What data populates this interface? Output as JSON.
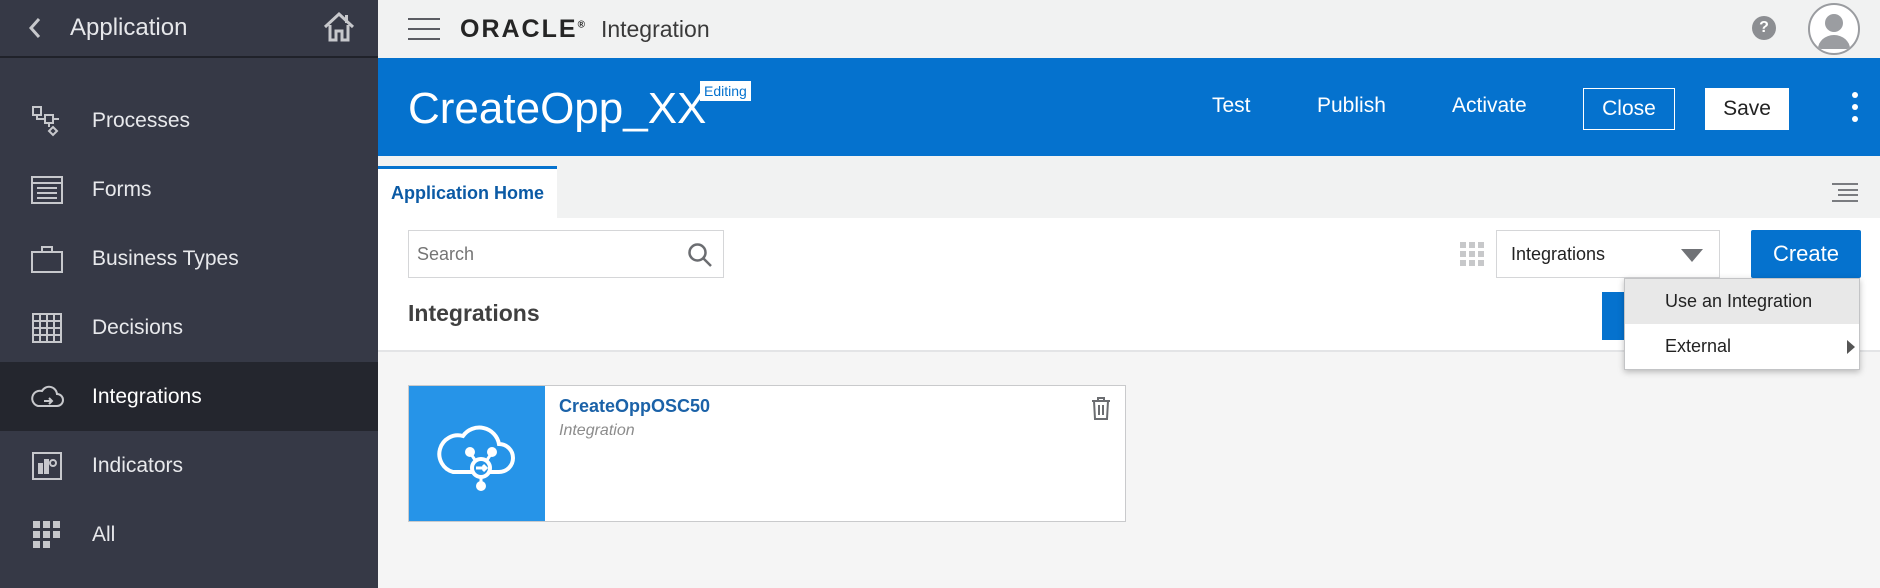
{
  "sidebar": {
    "title": "Application",
    "items": [
      {
        "label": "Processes",
        "icon": "process-icon"
      },
      {
        "label": "Forms",
        "icon": "form-icon"
      },
      {
        "label": "Business Types",
        "icon": "briefcase-icon"
      },
      {
        "label": "Decisions",
        "icon": "table-icon"
      },
      {
        "label": "Integrations",
        "icon": "cloud-icon",
        "active": true
      },
      {
        "label": "Indicators",
        "icon": "chart-icon"
      },
      {
        "label": "All",
        "icon": "grid-icon"
      }
    ]
  },
  "topbar": {
    "brand": "ORACLE",
    "product": "Integration",
    "help": "?"
  },
  "header": {
    "app_name": "CreateOpp_XX",
    "badge": "Editing",
    "test": "Test",
    "publish": "Publish",
    "activate": "Activate",
    "close": "Close",
    "save": "Save"
  },
  "tabs": {
    "active": "Application Home"
  },
  "toolbar": {
    "search_placeholder": "Search",
    "filter_value": "Integrations",
    "create": "Create"
  },
  "section": {
    "title": "Integrations"
  },
  "cards": [
    {
      "title": "CreateOppOSC50",
      "subtitle": "Integration"
    }
  ],
  "menu": {
    "items": [
      {
        "label": "Use an Integration"
      },
      {
        "label": "External"
      }
    ]
  },
  "colors": {
    "primary": "#0572ce",
    "sidebar": "#363946",
    "sidebar_active": "#24262e"
  }
}
